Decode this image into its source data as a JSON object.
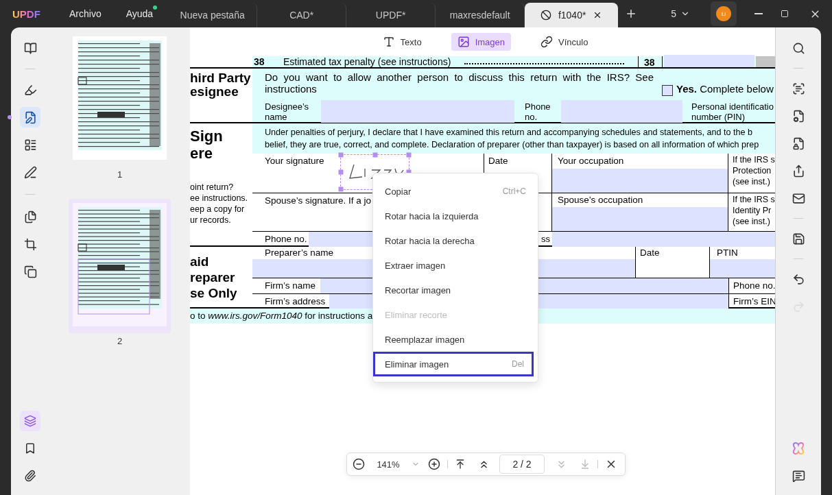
{
  "app": {
    "logo": "UPDF",
    "avatar": "Li",
    "window_count": "5"
  },
  "menu": [
    {
      "label": "Archivo",
      "badge": false
    },
    {
      "label": "Ayuda",
      "badge": true
    }
  ],
  "tabs": [
    {
      "label": "Nueva pestaña",
      "selected": false
    },
    {
      "label": "CAD*",
      "selected": false
    },
    {
      "label": "UPDF*",
      "selected": false
    },
    {
      "label": "maxresdefault",
      "selected": false
    },
    {
      "label": "f1040*",
      "selected": true
    }
  ],
  "left_rail": {
    "tools": [
      {
        "selected": false
      },
      {
        "selected": false
      },
      {
        "selected": true
      },
      {
        "selected": false
      },
      {
        "selected": false
      },
      {
        "selected": false
      },
      {
        "selected": false
      },
      {
        "selected": false
      }
    ],
    "panels": [
      {
        "selected": true
      },
      {
        "selected": false
      },
      {
        "selected": false
      }
    ]
  },
  "thumbnails": [
    {
      "label": "1",
      "selected": false
    },
    {
      "label": "2",
      "selected": true
    }
  ],
  "edit_modes": [
    {
      "label": "Texto",
      "selected": false
    },
    {
      "label": "Imagen",
      "selected": true
    },
    {
      "label": "Vínculo",
      "selected": false
    }
  ],
  "form": {
    "line_38": {
      "number": "38",
      "text": "Estimated tax penalty (see instructions)",
      "box_number": "38"
    },
    "third_party": {
      "heading": [
        "hird Party",
        "esignee"
      ],
      "question": "Do you want to allow another person to discuss this return with the IRS? See instructions",
      "yes_option": {
        "text": "**Yes.** Complete below",
        "checked": false
      },
      "designee_name": [
        "Designee’s",
        "name"
      ],
      "phone": [
        "Phone",
        "no."
      ],
      "pin": [
        "Personal identificatio",
        "number (PIN)"
      ]
    },
    "sign_here": {
      "heading": [
        "Sign",
        "ere"
      ],
      "note": [
        "oint return?",
        "ee instructions.",
        "eep a copy for",
        "ur records."
      ],
      "declaration": [
        "Under penalties of perjury, I declare that I have examined this return and accompanying schedules and statements, and to the b",
        "belief, they are true, correct, and complete. Declaration of preparer (other than taxpayer) is based on all information of which prep"
      ],
      "signature_label": "Your signature",
      "date_label": "Date",
      "occupation_label": "Your occupation",
      "irs_note": [
        "If the IRS s",
        "Protection",
        "(see inst.)"
      ],
      "spouse_label": "Spouse’s signature. If a jo",
      "spouse_occupation_label": "Spouse’s occupation",
      "spouse_irs_note": [
        "If the IRS s",
        "Identity Pr",
        "(see inst.)"
      ],
      "phone_label": "Phone no.",
      "email_label_fragment": "ss"
    },
    "paid_preparer": {
      "heading": [
        "aid",
        "reparer",
        "se Only"
      ],
      "preparer_name": "Preparer’s name",
      "date": "Date",
      "ptin": "PTIN",
      "firm_name": "Firm’s name",
      "phone": "Phone no.",
      "firm_address": "Firm’s address",
      "firm_ein": "Firm’s EIN"
    },
    "footer": "o to *www.irs.gov/Form1040* for instructions a"
  },
  "context_menu": [
    {
      "label": "Copiar",
      "shortcut": "Ctrl+C",
      "disabled": false,
      "highlighted": false
    },
    {
      "label": "Rotar hacia la izquierda",
      "disabled": false,
      "highlighted": false
    },
    {
      "label": "Rotar hacia la derecha",
      "disabled": false,
      "highlighted": false
    },
    {
      "label": "Extraer imagen",
      "disabled": false,
      "highlighted": false
    },
    {
      "label": "Recortar imagen",
      "disabled": false,
      "highlighted": false
    },
    {
      "label": "Eliminar recorte",
      "disabled": true,
      "highlighted": false
    },
    {
      "label": "Reemplazar imagen",
      "disabled": false,
      "highlighted": false
    },
    {
      "label": "Eliminar imagen",
      "shortcut": "Del",
      "disabled": false,
      "highlighted": true
    }
  ],
  "zoom_bar": {
    "zoom": "141%",
    "page": "2 / 2",
    "prev_disabled": false,
    "next_disabled": true
  },
  "right_rail": [
    {
      "disabled": false
    },
    {
      "disabled": false
    },
    {
      "disabled": false
    },
    {
      "disabled": false
    },
    {
      "disabled": false
    },
    {
      "disabled": false
    },
    {
      "disabled": false
    },
    {
      "disabled": false
    },
    {
      "disabled": true
    },
    {
      "disabled": false
    },
    {
      "disabled": false
    }
  ]
}
